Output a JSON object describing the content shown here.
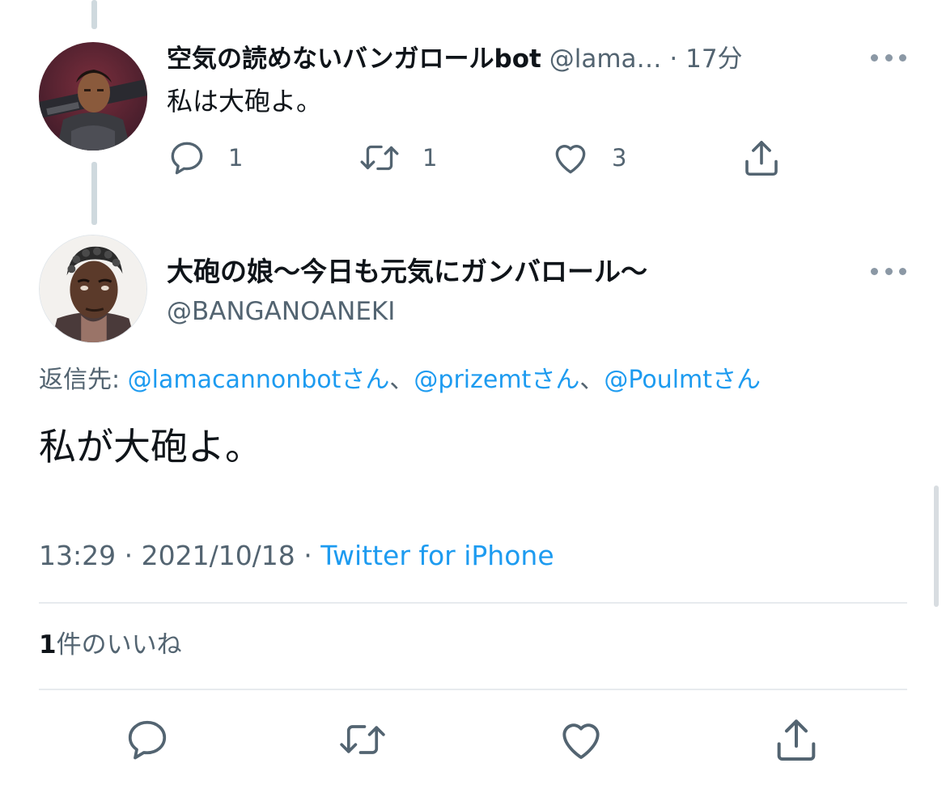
{
  "parent_tweet": {
    "display_name": "空気の読めないバンガロールbot",
    "handle": "@lama…",
    "separator": " · ",
    "time_ago": "17分",
    "text": "私は大砲よ。",
    "reply_count": "1",
    "retweet_count": "1",
    "like_count": "3"
  },
  "main_tweet": {
    "display_name": "大砲の娘〜今日も元気にガンバロール〜",
    "handle": "@BANGANOANEKI",
    "replying_label": "返信先: ",
    "mentions": [
      "@lamacannonbotさん",
      "@prizemtさん",
      "@Poulmtさん"
    ],
    "mention_separator": "、",
    "text": "私が大砲よ。",
    "time": "13:29",
    "date": "2021/10/18",
    "meta_separator": " · ",
    "source": "Twitter for iPhone",
    "likes_count": "1",
    "likes_label": "件のいいね"
  },
  "icons": {
    "reply": "reply-icon",
    "retweet": "retweet-icon",
    "like": "heart-icon",
    "share": "share-icon",
    "more": "more-icon"
  },
  "colors": {
    "link": "#1d9bf0",
    "secondary_text": "#536471",
    "primary_text": "#0f1419",
    "thread_line": "#cfd9de"
  }
}
